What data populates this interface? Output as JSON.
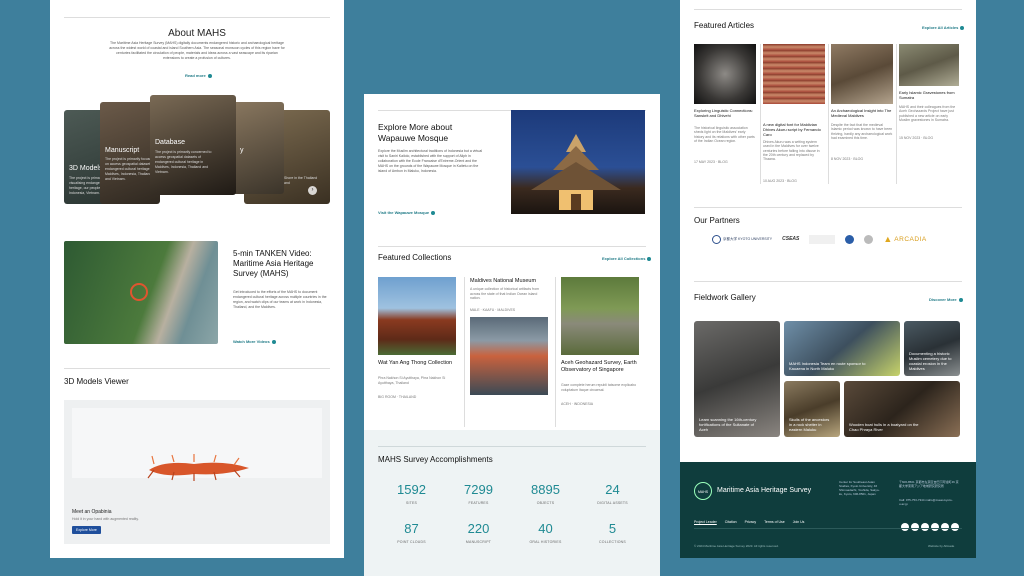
{
  "about": {
    "title": "About MAHS",
    "body": "The Maritime Asia Heritage Survey (MAHS) digitally documents endangered historic and archaeological heritage across the widest world of coastal and island Southern Asia. The seasonal monsoon cycles of this region have for centuries facilitated the circulation of people, materials and ideas across a vast seascape and its riparian extensions to create a profusion of cultures.",
    "read_more": "Read more"
  },
  "cards": [
    {
      "title": "3D Models",
      "desc": "The project is primarily visualising endangered heritage, our people, Maldives, Indonesia, Vietnam."
    },
    {
      "title": "Manuscript",
      "desc": "The project is primarily focused on access geospatial datasets of endangered cultural heritage in Maldives, Indonesia, Thailand and Vietnam."
    },
    {
      "title": "Database",
      "desc": "The project is primarily concerned to access geospatial datasets of endangered cultural heritage in Maldives, Indonesia, Thailand and Vietnam."
    },
    {
      "title": "y",
      "desc": ""
    },
    {
      "title": "",
      "desc": "Shore in the Thailand and"
    }
  ],
  "video": {
    "title": "5-min TANKEN Video: Maritime Asia Heritage Survey (MAHS)",
    "body": "Get introduced to the efforts of the MAHS to document endangered cultural heritage across multiple countries in the region, and watch clips of our teams at work in Indonesia, Thailand, and the Maldives.",
    "link": "Watch More Videos"
  },
  "viewer": {
    "title": "3D Models Viewer",
    "caption_title": "Meet an Opabinia",
    "caption_body": "Hold it in your hand with augmented reality.",
    "button": "Explore More"
  },
  "mosque": {
    "title": "Explore More about Wapauwe Mosque",
    "body": "Explore the Muslim architectural traditions of Indonesia but a virtual visit to Saniri Kailolo, established with the support of Aliph in collaboration with the Ecole Francaise d'Extreme-Orient and the MAHS on the grounds of the Wapauwe Mosque in Kaitetu on the island of Ambon in Maluku, Indonesia.",
    "link": "Visit the Wapauwe Mosque"
  },
  "collections": {
    "title": "Featured Collections",
    "explore": "Explore All Collections",
    "items": [
      {
        "title": "Wat Yan Ang Thong Collection",
        "body": "Phra Nakhon Si Ayutthaya, Phra Nakhon Si Ayutthaya, Thailand",
        "meta": "BIG ROOM · THAILAND"
      },
      {
        "title": "Maldives National Museum",
        "body": "A unique collection of historical artifacts from across the state of that Indian Ocean island nation.",
        "meta": "MALE · KAAFU · MALDIVES"
      },
      {
        "title": "Aceh Geohazard Survey, Earth Observatory of Singapore",
        "body": "Gaze complete herum republi tatsome explicabo voluptatum itaque circaesal.",
        "meta": "ACEH · INDONESIA"
      }
    ]
  },
  "accomplishments": {
    "title": "MAHS Survey Accomplishments",
    "stats": [
      {
        "n": "1592",
        "label": "SITES"
      },
      {
        "n": "7299",
        "label": "FEATURES"
      },
      {
        "n": "8895",
        "label": "OBJECTS"
      },
      {
        "n": "24",
        "label": "DIGITAL ASSETS"
      },
      {
        "n": "87",
        "label": "POINT CLOUDS"
      },
      {
        "n": "220",
        "label": "MANUSCRIPT"
      },
      {
        "n": "40",
        "label": "ORAL HISTORIES"
      },
      {
        "n": "5",
        "label": "COLLECTIONS"
      }
    ]
  },
  "articles": {
    "title": "Featured Articles",
    "explore": "Explore All Articles",
    "items": [
      {
        "title": "Exploring Linguistic Connections: Sanskrit and Dhivehi",
        "body": "The historical linguistic association sheds light on the Maldives' early history and its relations with other parts of the Indian Ocean region.",
        "meta": "17 MAY 2023 · BLOG"
      },
      {
        "title": "A new digital font for Maldivian Dhives Akuru script by Fernando Caro",
        "body": "Dhives Akuru was a writing system used in the Maldives for over twelve centuries before falling into disuse in the 20th century and replaced by Thaana.",
        "meta": "10 AUG 2023 · BLOG"
      },
      {
        "title": "An Archaeological Insight into The Medieval Maldives",
        "body": "Despite the fact that the medieval Islamic period was known to have been thriving, hardly any archaeological work had examined this time.",
        "meta": "8 NOV 2023 · BLOG"
      },
      {
        "title": "Early Islamic Gravestones from Sumatra",
        "body": "MAHS and their colleagues from the Aceh Geohazards Project have just published a new article on early Muslim gravestones in Sumatra.",
        "meta": "15 NOV 2023 · BLOG"
      }
    ]
  },
  "partners": {
    "title": "Our Partners",
    "items": [
      "京都大学 KYOTO UNIVERSITY",
      "CSEAS",
      "",
      "",
      "",
      "ARCADIA"
    ]
  },
  "gallery": {
    "title": "Fieldwork Gallery",
    "explore": "Discover More",
    "items": [
      "Learn scanning the 16th-century fortifications of the Sultanate of Aceh",
      "MAHS Indonesia Team en route sponsor to Kauaena in North Maluku",
      "Documenting a historic Muslim cemetery due to coastal erosion in the Maldives",
      "Skulls of the ancestors in a rock shelter in eastern Maluku",
      "Wooden boat hulls in a boatyard on the Chao Phraya River"
    ]
  },
  "footer": {
    "logo": "MAHS",
    "title": "Maritime Asia Heritage Survey",
    "address": "Center for Southeast Asian Studies, Kyoto University, 46 Shimoadachi, Yoshida, Sakyo-ku, Kyoto, 606-8501, Japan",
    "address_jp": "〒606-8501 京都市左京区吉田下阿達町46 京都大学東南アジア地域研究研究所",
    "contact": "Call: 075-753-7344 mahs@cseas.kyoto-u.ac.jp",
    "nav": [
      "Project Leader",
      "Citation",
      "Privacy",
      "Terms of Use",
      "Join Us"
    ],
    "copyright": "© 2024 Maritime Asia Heritage Survey 2023. All rights reserved.",
    "credit": "Website by Allmade"
  }
}
